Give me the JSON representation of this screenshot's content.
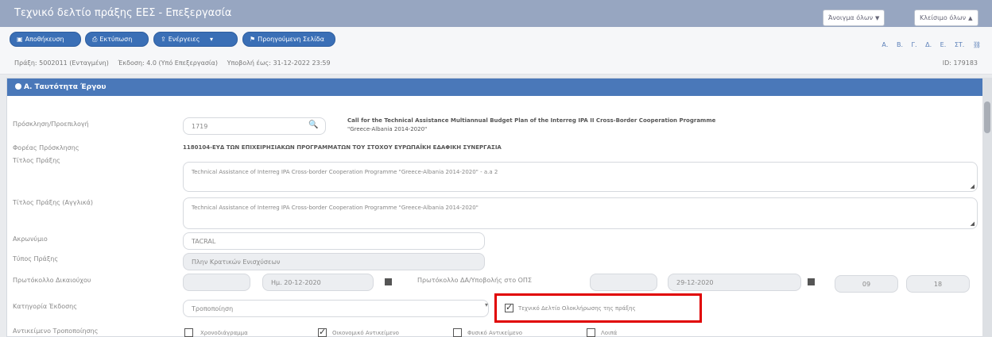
{
  "title": "Τεχνικό δελτίο πράξης ΕΕΣ - Επεξεργασία",
  "title_buttons": [
    {
      "label": "Άνοιγμα όλων"
    },
    {
      "label": "Κλείσιμο όλων"
    }
  ],
  "toolbar_buttons": [
    {
      "icon": "save-icon",
      "label": "Αποθήκευση"
    },
    {
      "icon": "print-icon",
      "label": "Εκτύπωση"
    },
    {
      "icon": "export-icon",
      "label": "Ενέργειες"
    },
    {
      "icon": "flag-icon",
      "label": "Προηγούμενη Σελίδα"
    }
  ],
  "section_letters": [
    "Α.",
    "Β.",
    "Γ.",
    "Δ.",
    "Ε.",
    "ΣΤ."
  ],
  "info": {
    "code": "Πράξη: 5002011 (Ενταγμένη)",
    "version": "Έκδοση: 4.0 (Υπό Επεξεργασία)",
    "deadline": "Υποβολή έως: 31-12-2022 23:59",
    "id": "ID: 179183"
  },
  "section_title": "Α. Ταυτότητα Έργου",
  "fields": {
    "call_label": "Πρόσκληση/Προεπιλογή",
    "call_value": "1719",
    "call_desc_line1": "Call for the Technical Assistance Multiannual Budget Plan of the Interreg IPA II Cross-Border Cooperation Programme",
    "call_desc_line2": "\"Greece-Albania 2014-2020\"",
    "body_label": "Φορέας Πρόσκλησης",
    "body_value": "1180104-ΕΥΔ ΤΩΝ ΕΠΙΧΕΙΡΗΣΙΑΚΩΝ ΠΡΟΓΡΑΜΜΑΤΩΝ ΤΟΥ ΣΤΟΧΟΥ ΕΥΡΩΠΑΪΚΗ ΕΔΑΦΙΚΗ ΣΥΝΕΡΓΑΣΙΑ",
    "title_label": "Τίτλος Πράξης",
    "title_value": "Technical Assistance of Interreg IPA Cross-border Cooperation Programme \"Greece-Albania 2014-2020\" - a.a 2",
    "title_en_label": "Τίτλος Πράξης (Αγγλικά)",
    "title_en_value": "Technical Assistance of Interreg IPA Cross-border Cooperation Programme \"Greece-Albania 2014-2020\"",
    "acronym_label": "Ακρωνύμιο",
    "acronym_value": "TACRAL",
    "type_label": "Τύπος Πράξης",
    "type_value": "Πλην Κρατικών Ενισχύσεων",
    "protocol_label": "Πρωτόκολλο Δικαιούχου",
    "protocol_date": "Ημ. 20-12-2020",
    "protocol_ops_label": "Πρωτόκολλο ΔΑ/Υποβολής στο ΟΠΣ",
    "protocol_ops_date": "29-12-2020",
    "protocol_ops_hh": "09",
    "protocol_ops_mm": "18",
    "version_cat_label": "Κατηγορία Έκδοσης",
    "version_cat_value": "Τροποποίηση",
    "closure_check_label": "Τεχνικό Δελτίο Ολοκλήρωσης της πράξης",
    "mod_object_label": "Αντικείμενο Τροποποίησης",
    "mod_options": [
      {
        "label": "Χρονοδιάγραμμα",
        "checked": false
      },
      {
        "label": "Οικονομικό Αντικείμενο",
        "checked": true
      },
      {
        "label": "Φυσικό Αντικείμενο",
        "checked": false
      },
      {
        "label": "Λοιπά",
        "checked": false
      }
    ]
  }
}
